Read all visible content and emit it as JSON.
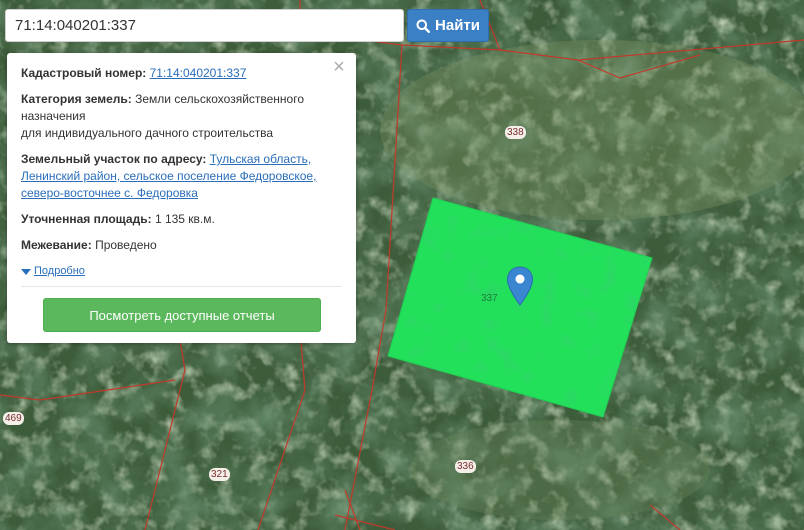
{
  "search": {
    "value": "71:14:040201:337",
    "button_label": "Найти",
    "button_icon": "search-icon"
  },
  "popup": {
    "cadastral_label": "Кадастровый номер:",
    "cadastral_value": "71:14:040201:337",
    "category_label": "Категория земель:",
    "category_value_line1": "Земли сельскохозяйственного назначения",
    "category_value_line2": "для индивидуального дачного строительства",
    "address_label": "Земельный участок по адресу:",
    "address_value": "Тульская область, Ленинский район, сельское поселение Федоровское, северо-восточнее с. Федоровка",
    "area_label": "Уточненная площадь:",
    "area_value": "1 135 кв.м.",
    "survey_label": "Межевание:",
    "survey_value": "Проведено",
    "details_link": "Подробно",
    "reports_button": "Посмотреть доступные отчеты",
    "close_icon": "close-icon"
  },
  "map": {
    "selected_parcel_label": "337",
    "parcel_labels": [
      "338",
      "336",
      "321",
      "469"
    ],
    "colors": {
      "parcel_fill": "#22e05a",
      "boundary": "#c0392b",
      "marker": "#3a86d0",
      "button_primary": "#3b7fc4",
      "button_success": "#5cb85c"
    }
  }
}
